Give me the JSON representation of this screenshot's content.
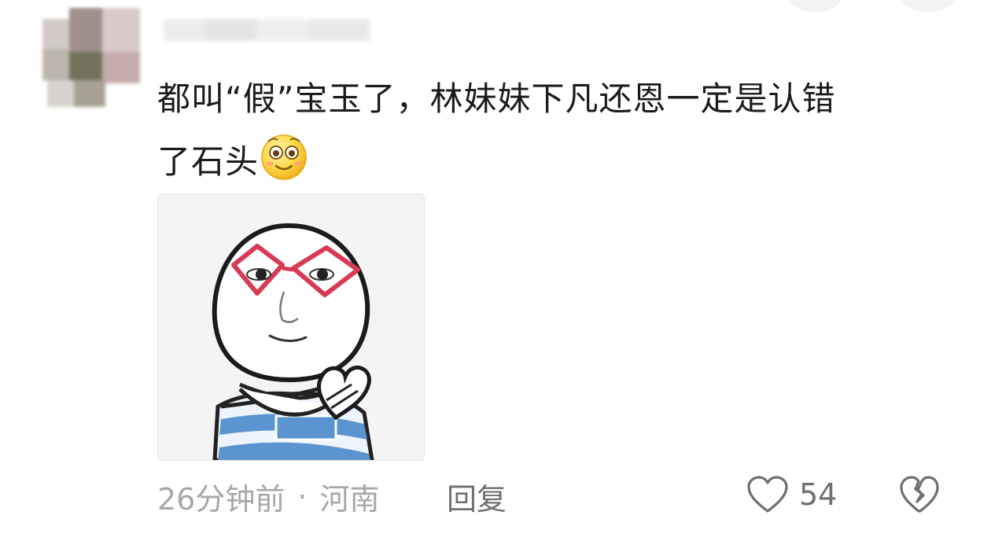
{
  "comment": {
    "text_line1": "都叫“假”宝玉了，林妹妹下凡还恩一定是认错",
    "text_line2": "了石头",
    "emoji_icon": "smiling-face-emoji-icon",
    "sticker": "meme-sticker-red-glasses-heart-hands",
    "time": "26分钟前",
    "separator": "·",
    "location": "河南",
    "reply_label": "回复",
    "like_count": "54",
    "like_icon": "heart-outline-icon",
    "dislike_icon": "broken-heart-icon"
  }
}
